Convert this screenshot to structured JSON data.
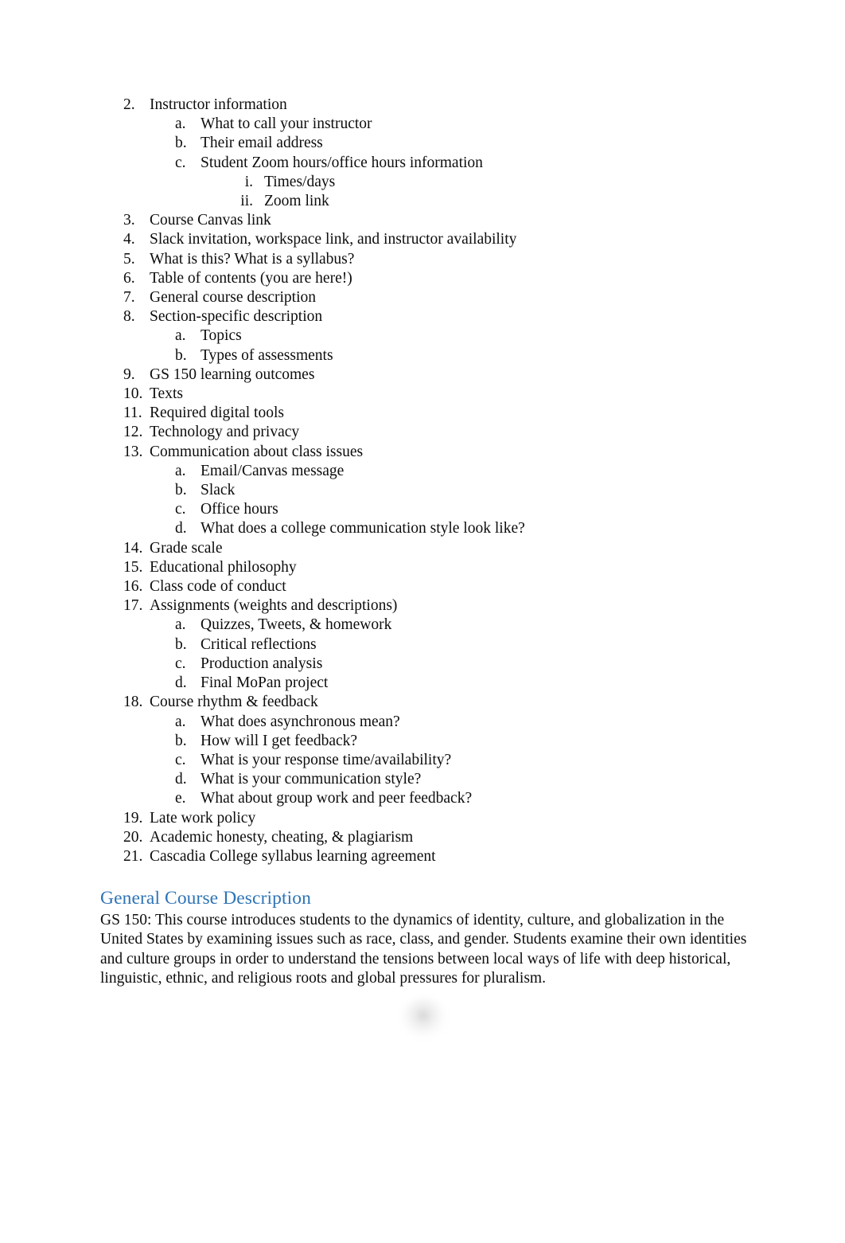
{
  "document": {
    "page_background": "#ffffff",
    "text_color": "#0d0d0d",
    "heading_color": "#2e74b5"
  },
  "outline": {
    "items": [
      {
        "number": "2.",
        "text": "Instructor information",
        "children": [
          {
            "number": "a.",
            "text": "What to call your instructor"
          },
          {
            "number": "b.",
            "text": "Their email address"
          },
          {
            "number": "c.",
            "text": "Student Zoom hours/office hours information",
            "children": [
              {
                "number": "i.",
                "text": "Times/days"
              },
              {
                "number": "ii.",
                "text": "Zoom link"
              }
            ]
          }
        ]
      },
      {
        "number": "3.",
        "text": "Course Canvas link"
      },
      {
        "number": "4.",
        "text": "Slack invitation, workspace link, and instructor availability"
      },
      {
        "number": "5.",
        "text": "What is this? What is a syllabus?"
      },
      {
        "number": "6.",
        "text": "Table of contents (you are here!)"
      },
      {
        "number": "7.",
        "text": "General course description"
      },
      {
        "number": "8.",
        "text": "Section-specific description",
        "children": [
          {
            "number": "a.",
            "text": "Topics"
          },
          {
            "number": "b.",
            "text": "Types of assessments"
          }
        ]
      },
      {
        "number": "9.",
        "text": "GS 150 learning outcomes"
      },
      {
        "number": "10.",
        "text": "Texts"
      },
      {
        "number": "11.",
        "text": "Required digital tools"
      },
      {
        "number": "12.",
        "text": "Technology and privacy"
      },
      {
        "number": "13.",
        "text": "Communication about class issues",
        "children": [
          {
            "number": "a.",
            "text": "Email/Canvas message"
          },
          {
            "number": "b.",
            "text": "Slack"
          },
          {
            "number": "c.",
            "text": "Office hours"
          },
          {
            "number": "d.",
            "text": "What does a college communication style look like?"
          }
        ]
      },
      {
        "number": "14.",
        "text": "Grade scale"
      },
      {
        "number": "15.",
        "text": "Educational philosophy"
      },
      {
        "number": "16.",
        "text": "Class code of conduct"
      },
      {
        "number": "17.",
        "text": "Assignments (weights and descriptions)",
        "children": [
          {
            "number": "a.",
            "text": "Quizzes, Tweets, & homework"
          },
          {
            "number": "b.",
            "text": "Critical reflections"
          },
          {
            "number": "c.",
            "text": "Production analysis"
          },
          {
            "number": "d.",
            "text": "Final MoPan project"
          }
        ]
      },
      {
        "number": "18.",
        "text": "Course rhythm & feedback",
        "children": [
          {
            "number": "a.",
            "text": "What does asynchronous mean?"
          },
          {
            "number": "b.",
            "text": "How will I get feedback?"
          },
          {
            "number": "c.",
            "text": "What is your response time/availability?"
          },
          {
            "number": "d.",
            "text": "What is your communication style?"
          },
          {
            "number": "e.",
            "text": "What about group work and peer feedback?"
          }
        ]
      },
      {
        "number": "19.",
        "text": "Late work policy"
      },
      {
        "number": "20.",
        "text": "Academic honesty, cheating, & plagiarism"
      },
      {
        "number": "21.",
        "text": "Cascadia College syllabus learning agreement"
      }
    ]
  },
  "section": {
    "heading": "General Course Description",
    "paragraph": "GS 150:  This course introduces students to the dynamics of identity, culture, and globalization in the United States by examining issues such as race, class, and gender. Students examine their own identities and culture groups in order to understand the tensions between local ways of life with deep historical, linguistic, ethnic, and religious roots and global pressures for pluralism."
  }
}
